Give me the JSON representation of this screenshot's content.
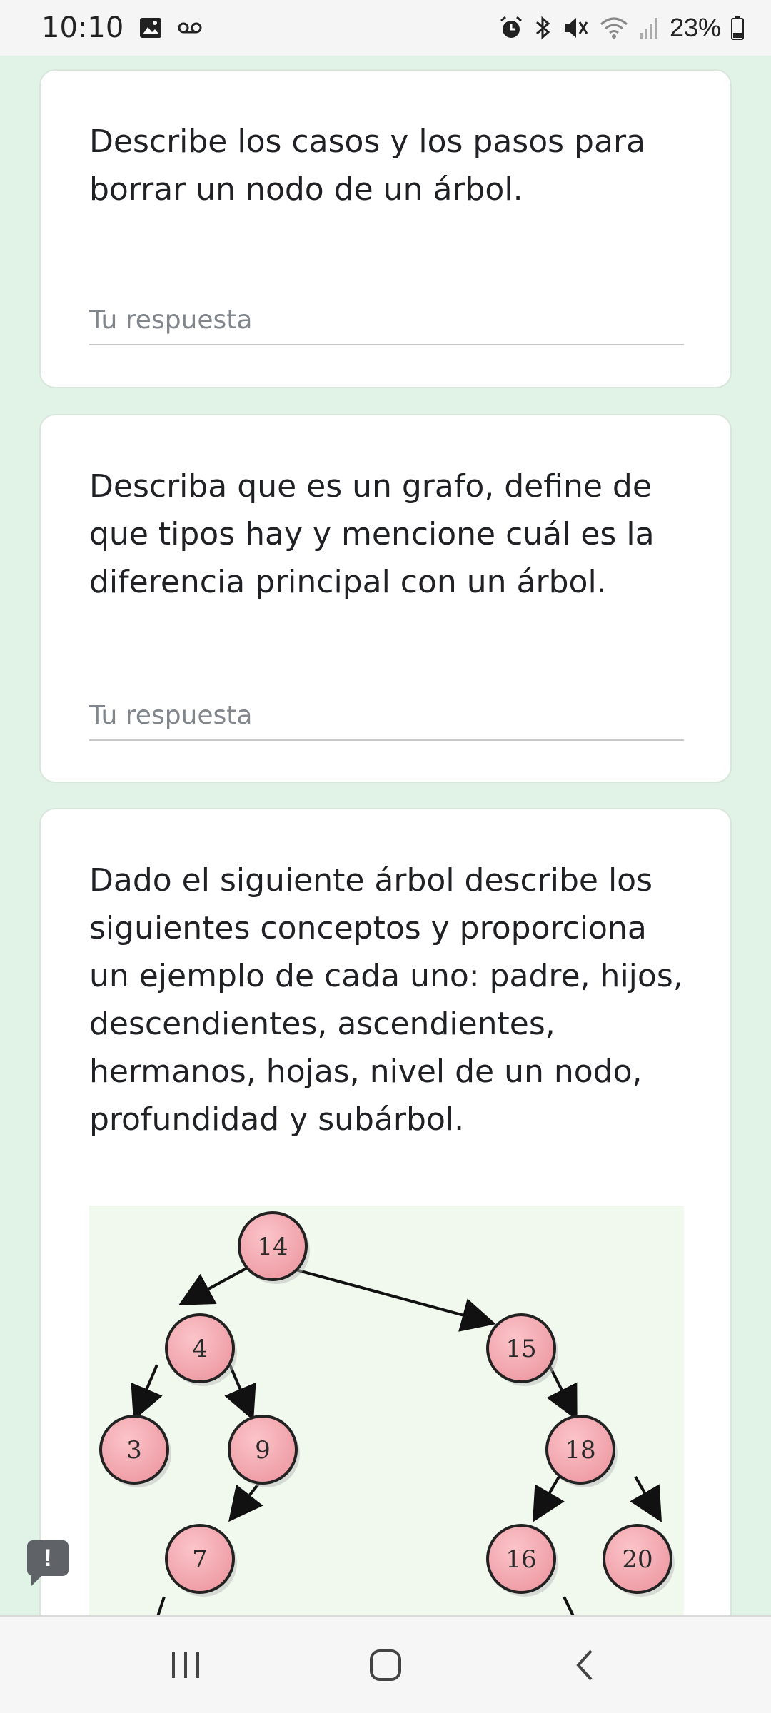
{
  "status_bar": {
    "time": "10:10",
    "battery": "23%",
    "left_icons": [
      "image-icon",
      "voicemail-icon"
    ],
    "right_icons": [
      "alarm-icon",
      "bluetooth-icon",
      "mute-icon",
      "wifi-icon",
      "signal-icon",
      "battery-icon"
    ]
  },
  "questions": [
    {
      "text": "Describe los casos y los pasos para borrar un nodo de un árbol.",
      "answer_placeholder": "Tu respuesta",
      "answer_value": ""
    },
    {
      "text": "Describa que es un grafo, define de que tipos hay y mencione cuál es la diferencia principal con un árbol.",
      "answer_placeholder": "Tu respuesta",
      "answer_value": ""
    },
    {
      "text": "Dado el siguiente árbol describe los siguientes conceptos y proporciona un ejemplo de cada uno: padre, hijos, descendientes, ascendientes, hermanos, hojas, nivel de un nodo, profundidad y subárbol."
    }
  ],
  "tree": {
    "nodes": [
      "14",
      "4",
      "15",
      "3",
      "9",
      "18",
      "7",
      "16",
      "20"
    ],
    "node_fill": "#f4a7ae",
    "background": "#f1f9ee"
  },
  "feedback": {
    "symbol": "!"
  },
  "colors": {
    "page_background": "#e1f2e6",
    "card_background": "#ffffff",
    "text": "#202124"
  }
}
